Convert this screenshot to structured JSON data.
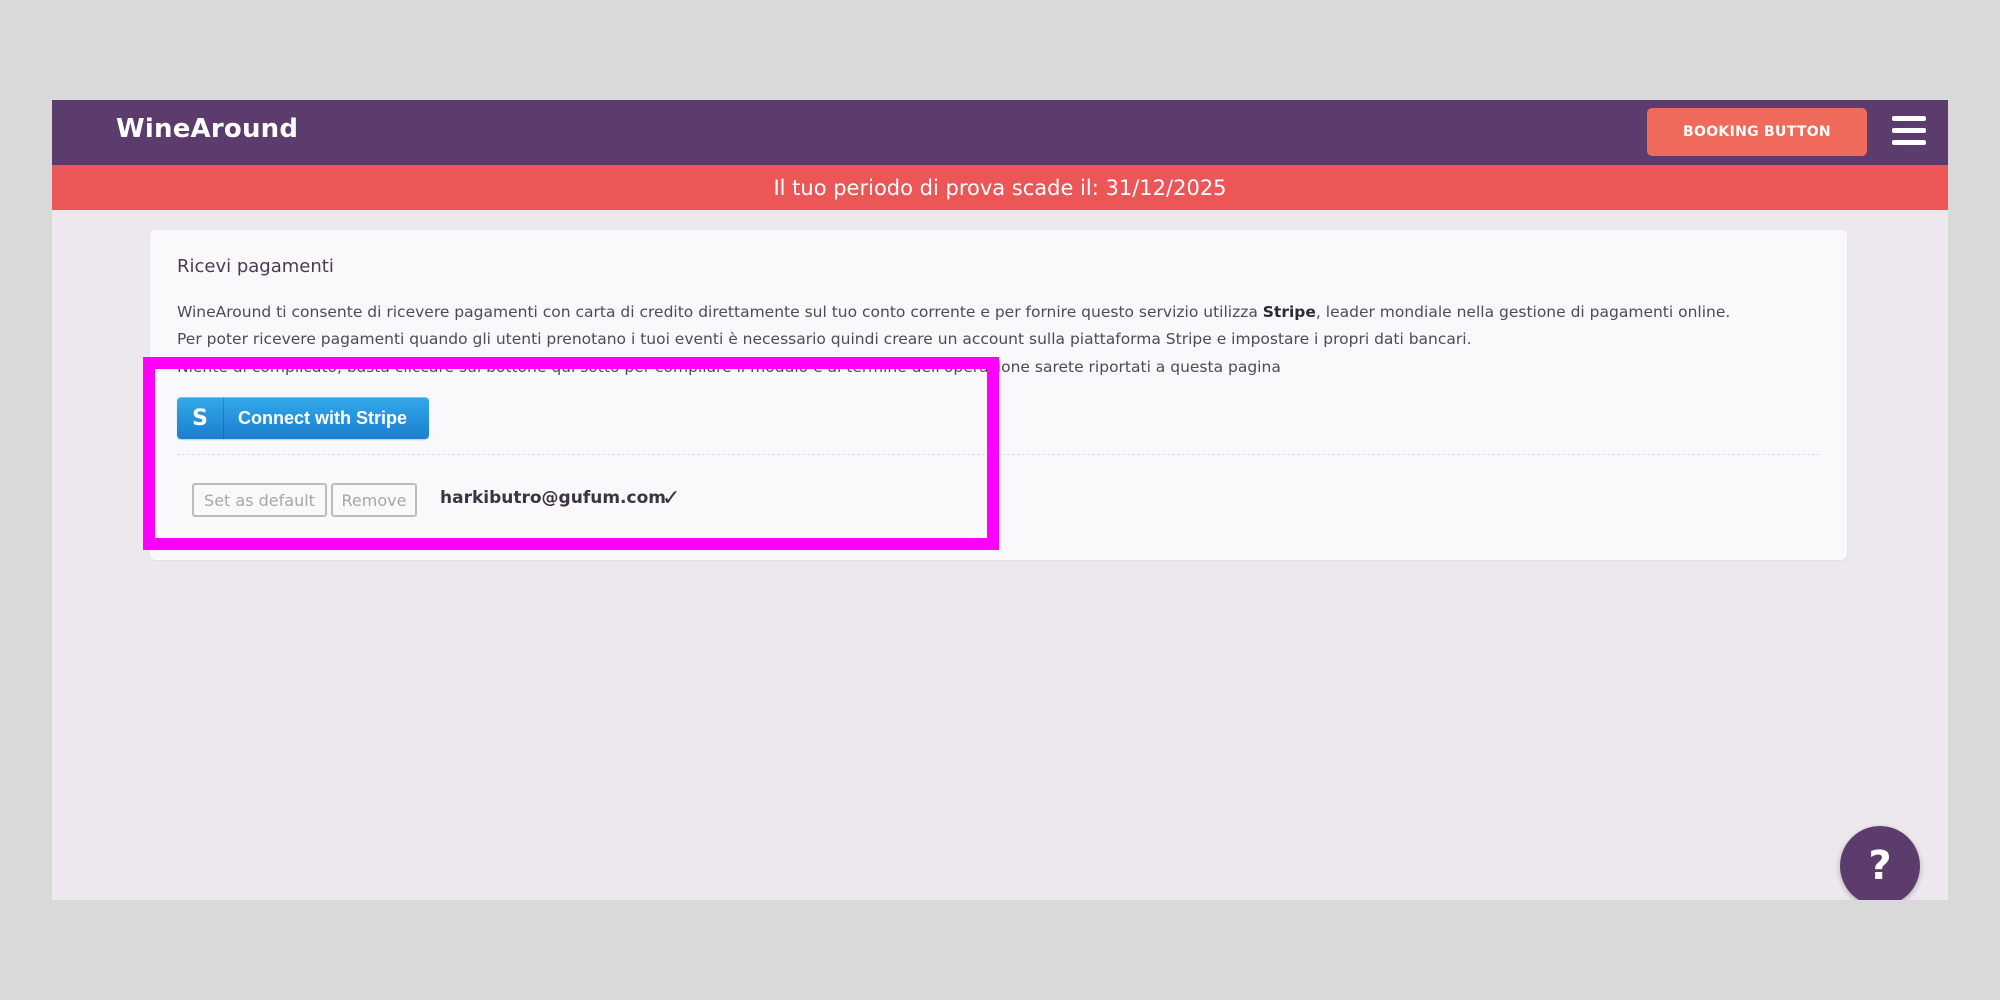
{
  "header": {
    "logo_text": "WineAround",
    "booking_button_label": "BOOKING BUTTON",
    "menu_icon": "hamburger-menu-icon",
    "background_color": "#5b3c6c",
    "booking_button_color": "#ef6a5a"
  },
  "trial_banner": {
    "text": "Il tuo periodo di prova scade il: 31/12/2025",
    "background_color": "#ec5656"
  },
  "payments_card": {
    "title": "Ricevi pagamenti",
    "line1_part1": "WineAround ti consente di ricevere pagamenti con carta di credito direttamente sul tuo conto corrente e per fornire questo servizio utilizza ",
    "line1_bold": "Stripe",
    "line1_part2": ", leader mondiale nella gestione di pagamenti online.",
    "line2": "Per poter ricevere pagamenti quando gli utenti prenotano i tuoi eventi è necessario quindi creare un account sulla piattaforma Stripe e impostare i propri dati bancari.",
    "line3": "Niente di complicato, basta cliccare sul bottone qui sotto per compilare il modulo e al termine dell'operazione sarete riportati a questa pagina",
    "connect_button": {
      "icon_letter": "S",
      "label": "Connect with Stripe"
    },
    "account": {
      "set_default_label": "Set as default",
      "remove_label": "Remove",
      "email": "harkibutro@gufum.com",
      "check_mark": "✓"
    }
  },
  "help_button": {
    "label": "?",
    "icon": "help-icon"
  },
  "highlight": {
    "color": "#ff00ff"
  }
}
